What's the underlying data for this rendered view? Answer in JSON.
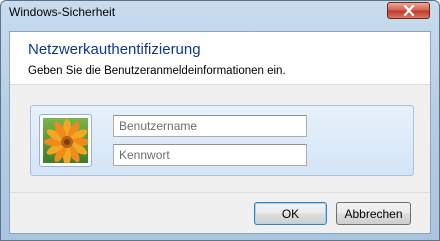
{
  "window": {
    "title": "Windows-Sicherheit"
  },
  "dialog": {
    "heading": "Netzwerkauthentifizierung",
    "subtitle": "Geben Sie die Benutzeranmeldeinformationen ein."
  },
  "credentials": {
    "username_placeholder": "Benutzername",
    "password_placeholder": "Kennwort"
  },
  "buttons": {
    "ok_label": "OK",
    "cancel_label": "Abbrechen"
  },
  "icons": {
    "close": "close-icon",
    "avatar": "user-flower-avatar-icon"
  },
  "colors": {
    "heading": "#0e3793",
    "close_button": "#c0392b",
    "tile_border": "#a7c2de"
  }
}
